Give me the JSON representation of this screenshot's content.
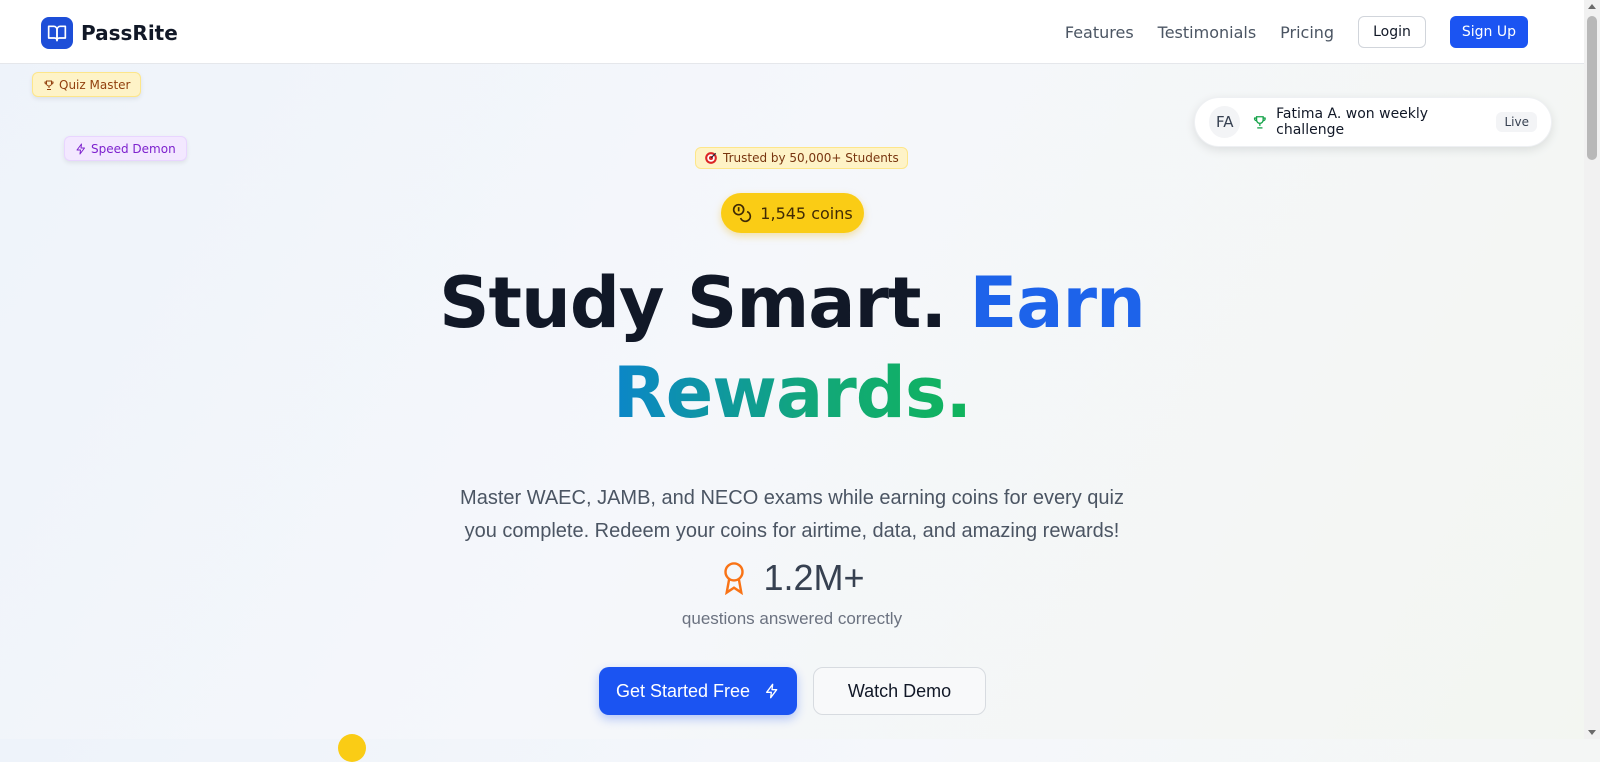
{
  "brand": {
    "name": "PassRite",
    "accent": "#1b54f2"
  },
  "nav": {
    "links": [
      "Features",
      "Testimonials",
      "Pricing"
    ],
    "login_label": "Login",
    "signup_label": "Sign Up"
  },
  "floating_badges": {
    "quiz_master": "Quiz Master",
    "speed_demon": "Speed Demon"
  },
  "live_feed": {
    "avatar_initials": "FA",
    "message": "Fatima A. won weekly challenge",
    "tag": "Live"
  },
  "hero": {
    "trusted_badge": "Trusted by 50,000+ Students",
    "coins": "1,545 coins",
    "headline_part1": "Study Smart.",
    "headline_part2": "Earn",
    "headline_part3": "Rewards.",
    "subtitle": "Master WAEC, JAMB, and NECO exams while earning coins for every quiz you complete. Redeem your coins for airtime, data, and amazing rewards!",
    "stat_value": "1.2M+",
    "stat_label": "questions answered correctly",
    "cta_primary": "Get Started Free",
    "cta_secondary": "Watch Demo"
  },
  "icons": {
    "logo": "book-open-icon",
    "quiz_master": "trophy-icon",
    "speed_demon": "lightning-icon",
    "live_feed": "trophy-icon",
    "trusted": "target-icon",
    "coins": "coins-icon",
    "stat": "award-ribbon-icon",
    "cta": "lightning-icon"
  }
}
